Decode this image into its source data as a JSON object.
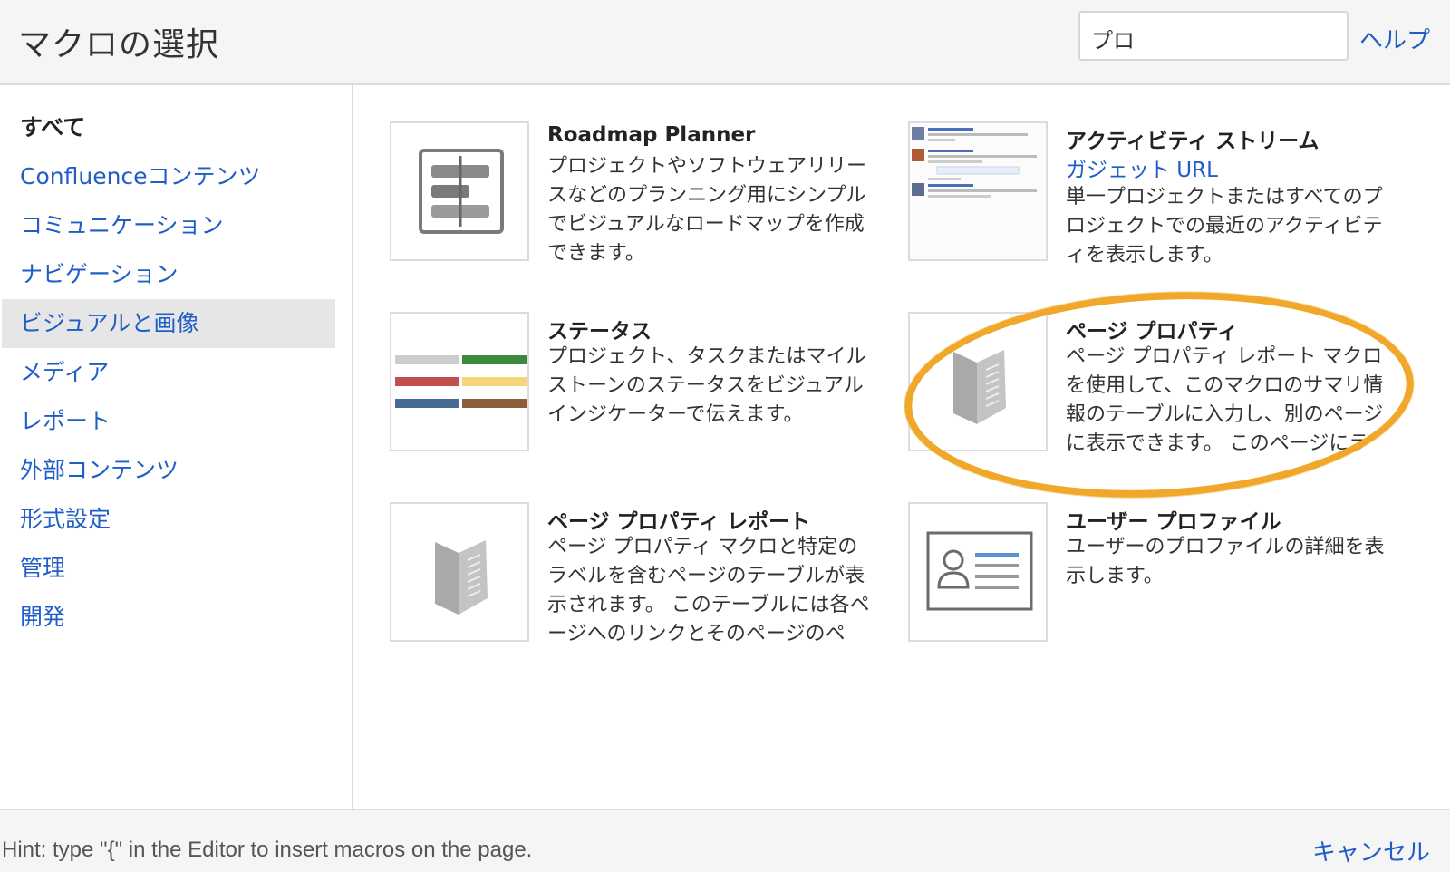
{
  "header": {
    "title": "マクロの選択",
    "search_value": "プロ",
    "help_label": "ヘルプ"
  },
  "sidebar": {
    "items": [
      {
        "label": "すべて"
      },
      {
        "label": "Confluenceコンテンツ"
      },
      {
        "label": "コミュニケーション"
      },
      {
        "label": "ナビゲーション"
      },
      {
        "label": "ビジュアルと画像",
        "selected": true
      },
      {
        "label": "メディア"
      },
      {
        "label": "レポート"
      },
      {
        "label": "外部コンテンツ"
      },
      {
        "label": "形式設定"
      },
      {
        "label": "管理"
      },
      {
        "label": "開発"
      }
    ]
  },
  "macros": [
    {
      "name": "Roadmap Planner",
      "description": "プロジェクトやソフトウェアリリースなどのプランニング用にシンプルでビジュアルなロードマップを作成できます。",
      "icon": "roadmap-icon"
    },
    {
      "name": "アクティビティ ストリーム",
      "subtitle": "ガジェット URL",
      "description": "単一プロジェクトまたはすべてのプロジェクトでの最近のアクティビティを表示します。",
      "icon": "activity-stream-thumbnail"
    },
    {
      "name": "ステータス",
      "description": "プロジェクト、タスクまたはマイルストーンのステータスをビジュアルインジケーターで伝えます。",
      "icon": "status-lozenges-icon"
    },
    {
      "name": "ページ プロパティ",
      "description": "ページ プロパティ レポート マクロを使用して、このマクロのサマリ情報のテーブルに入力し、別のページに表示できます。 このページにラ",
      "icon": "page-properties-icon",
      "highlighted": true
    },
    {
      "name": "ページ プロパティ レポート",
      "description": "ページ プロパティ マクロと特定のラベルを含むページのテーブルが表示されます。 このテーブルには各ページへのリンクとそのページのペ",
      "icon": "page-properties-report-icon"
    },
    {
      "name": "ユーザー プロファイル",
      "description": "ユーザーのプロファイルの詳細を表示します。",
      "icon": "user-profile-icon"
    }
  ],
  "colors": {
    "link": "#205ec7",
    "highlight": "#f0a72a",
    "status_grey": "#cccccc",
    "status_green": "#3b8a3b",
    "status_red": "#c0504d",
    "status_yellow": "#f6d57a",
    "status_blue": "#4a6a96",
    "status_brown": "#8b5e3c"
  },
  "footer": {
    "hint": "Hint: type \"{\" in the Editor to insert macros on the page.",
    "cancel_label": "キャンセル"
  }
}
